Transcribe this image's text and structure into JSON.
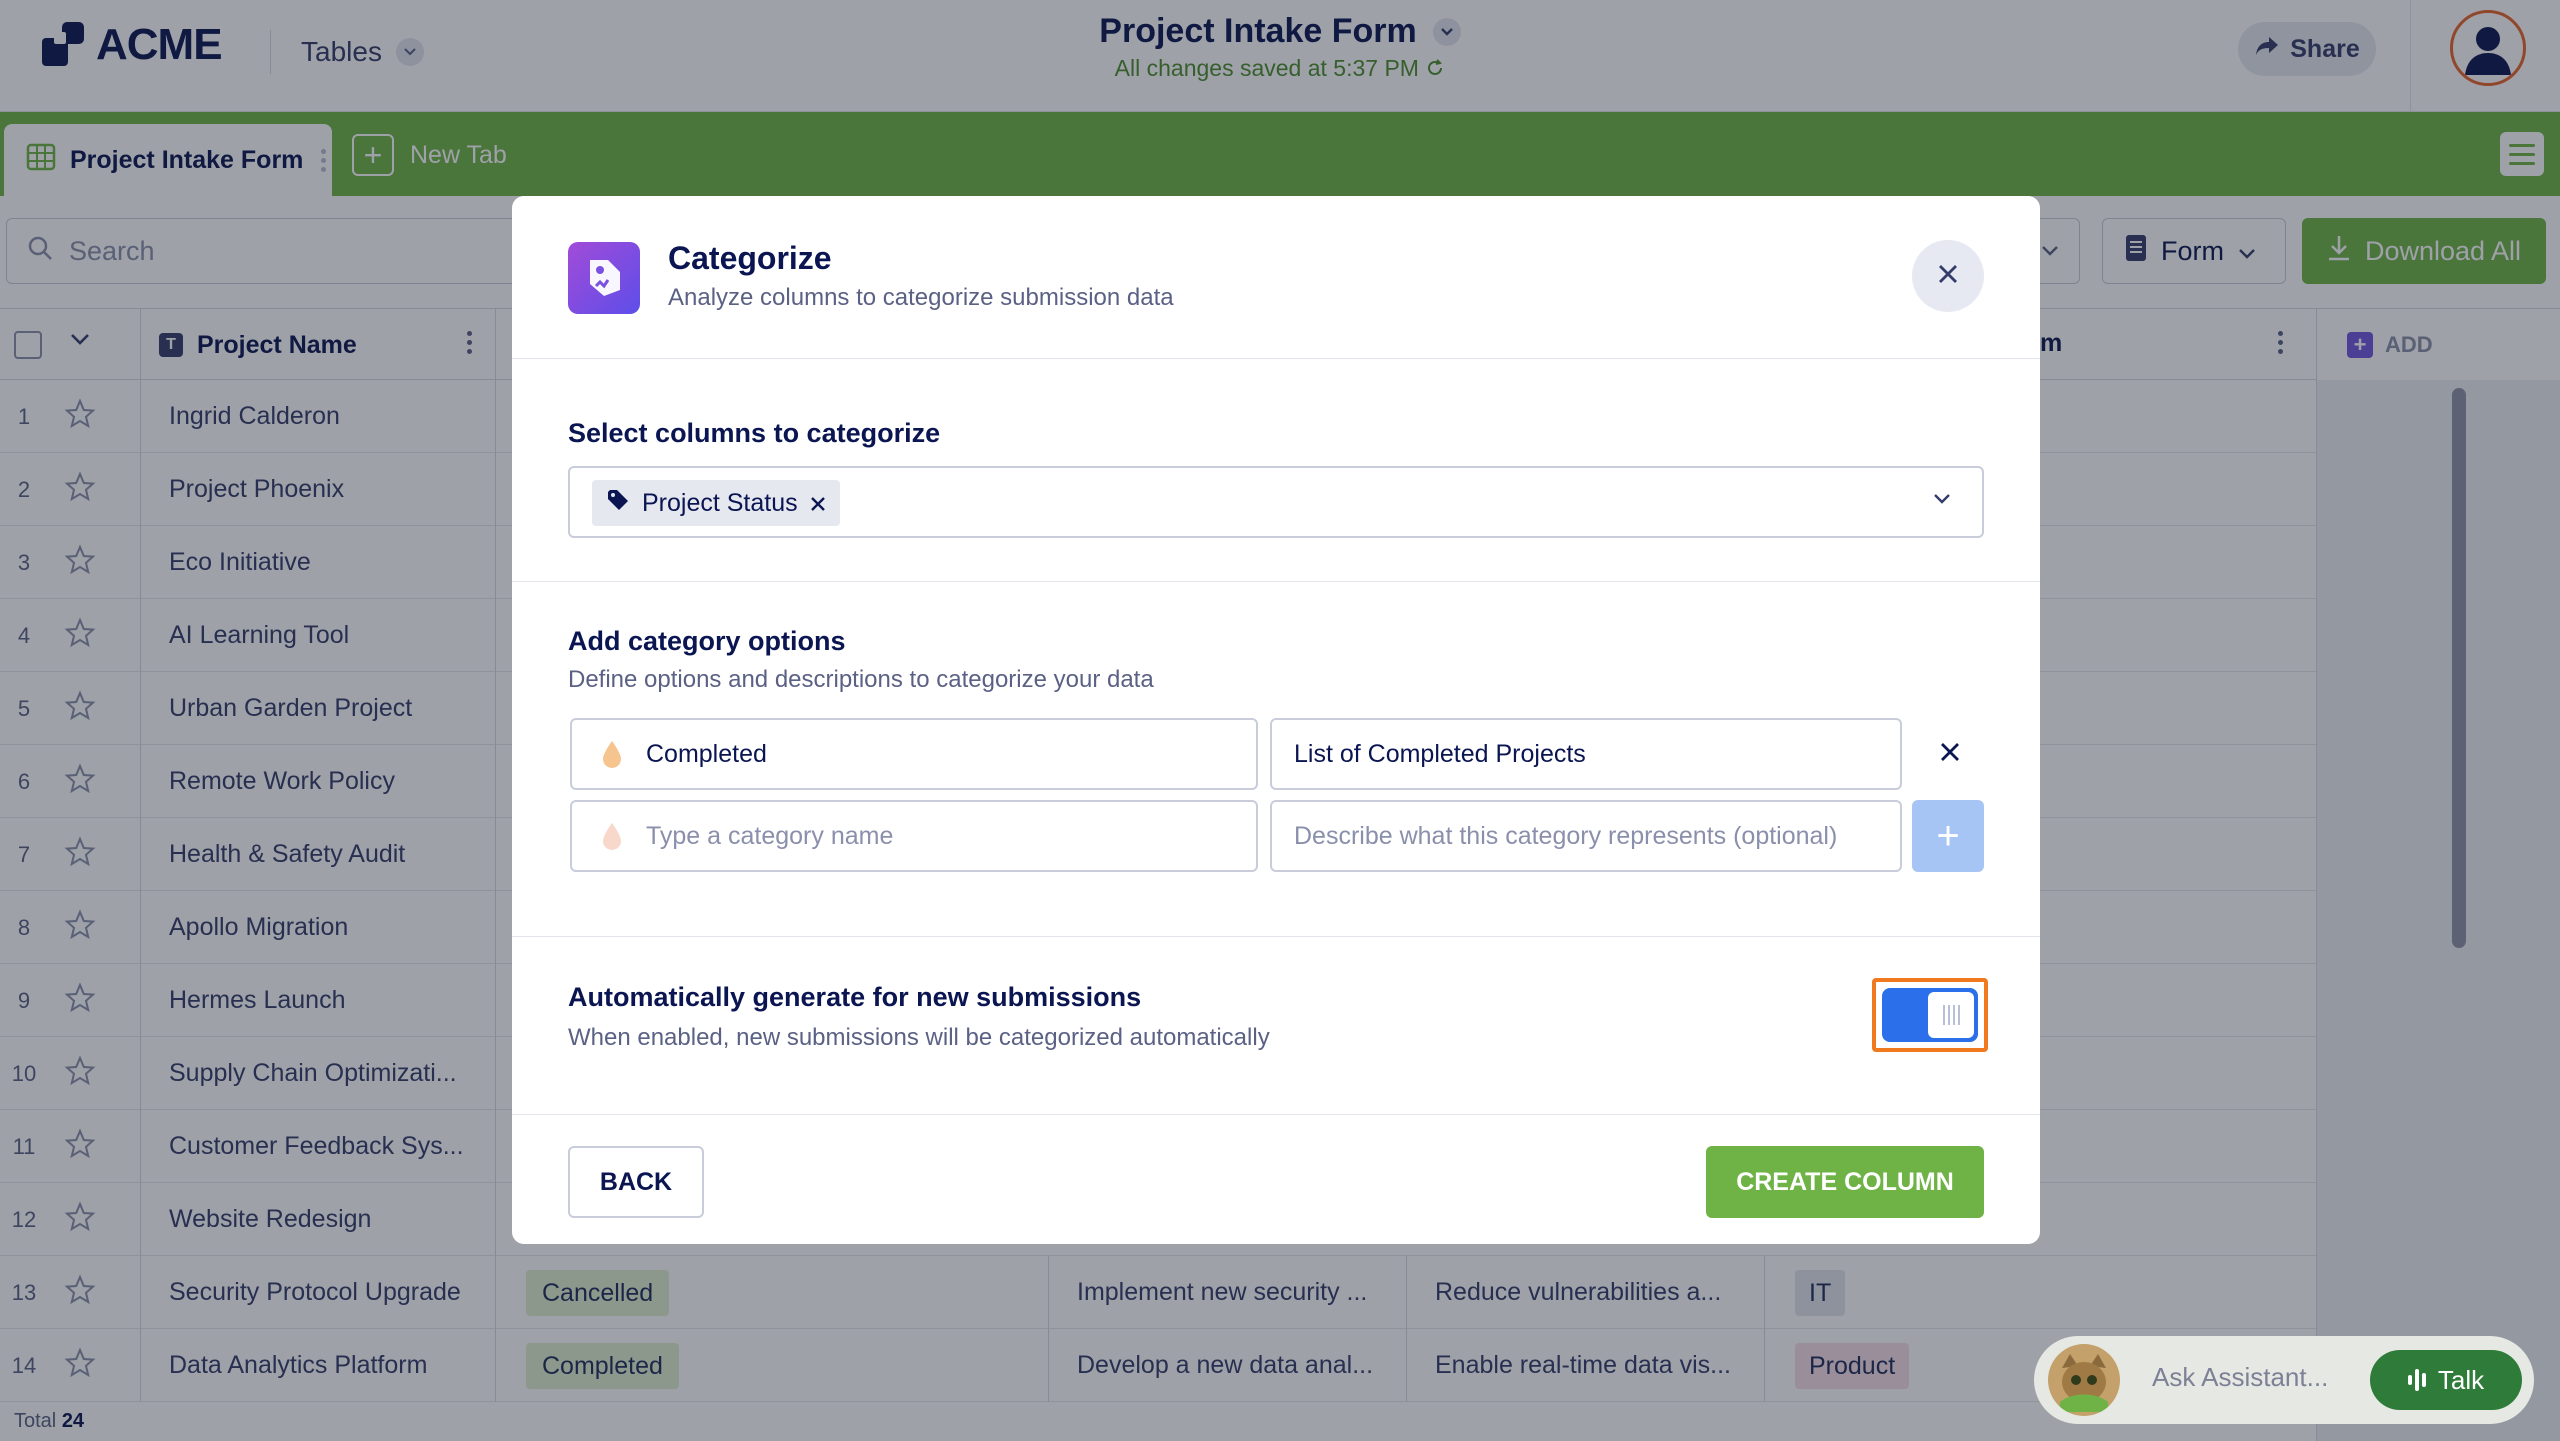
{
  "header": {
    "logo_text": "ACME",
    "tables_label": "Tables",
    "form_title": "Project Intake Form",
    "saved_status": "All changes saved at 5:37 PM",
    "share_label": "Share"
  },
  "tabs": {
    "active_label": "Project Intake Form",
    "new_tab_label": "New Tab"
  },
  "toolbar": {
    "search_placeholder": "Search",
    "form_label": "Form",
    "download_label": "Download All"
  },
  "table": {
    "header_name": "Project Name",
    "header_right_fragment": "m",
    "add_label": "ADD",
    "total_label": "Total",
    "total_count": "24",
    "rows": [
      {
        "n": "1",
        "name": "Ingrid Calderon"
      },
      {
        "n": "2",
        "name": "Project Phoenix"
      },
      {
        "n": "3",
        "name": "Eco Initiative"
      },
      {
        "n": "4",
        "name": "AI Learning Tool"
      },
      {
        "n": "5",
        "name": "Urban Garden Project"
      },
      {
        "n": "6",
        "name": "Remote Work Policy"
      },
      {
        "n": "7",
        "name": "Health & Safety Audit"
      },
      {
        "n": "8",
        "name": "Apollo Migration"
      },
      {
        "n": "9",
        "name": "Hermes Launch"
      },
      {
        "n": "10",
        "name": "Supply Chain Optimizati..."
      },
      {
        "n": "11",
        "name": "Customer Feedback Sys..."
      },
      {
        "n": "12",
        "name": "Website Redesign"
      },
      {
        "n": "13",
        "name": "Security Protocol Upgrade",
        "status": "Cancelled",
        "description": "Implement new security ...",
        "goal": "Reduce vulnerabilities a...",
        "dept": "IT",
        "dept_color": "#e3e5ee"
      },
      {
        "n": "14",
        "name": "Data Analytics Platform",
        "status": "Completed",
        "description": "Develop a new data anal...",
        "goal": "Enable real-time data vis...",
        "dept": "Product",
        "dept_color": "#f7dfe7"
      }
    ]
  },
  "modal": {
    "title": "Categorize",
    "subtitle": "Analyze columns to categorize submission data",
    "select_label": "Select columns to categorize",
    "selected_chip": "Project Status",
    "options_label": "Add category options",
    "options_sub": "Define options and descriptions to categorize your data",
    "option_1_name": "Completed",
    "option_1_desc": "List of Completed Projects",
    "new_name_placeholder": "Type a category name",
    "new_desc_placeholder": "Describe what this category represents (optional)",
    "auto_label": "Automatically generate for new submissions",
    "auto_sub": "When enabled, new submissions will be categorized automatically",
    "auto_enabled": true,
    "back_label": "BACK",
    "create_label": "CREATE COLUMN"
  },
  "assistant": {
    "placeholder": "Ask Assistant...",
    "talk_label": "Talk"
  },
  "colors": {
    "brand_green": "#6fb346",
    "navy": "#0a1551",
    "toggle_blue": "#2b6fea",
    "focus_orange": "#f07a1d"
  }
}
